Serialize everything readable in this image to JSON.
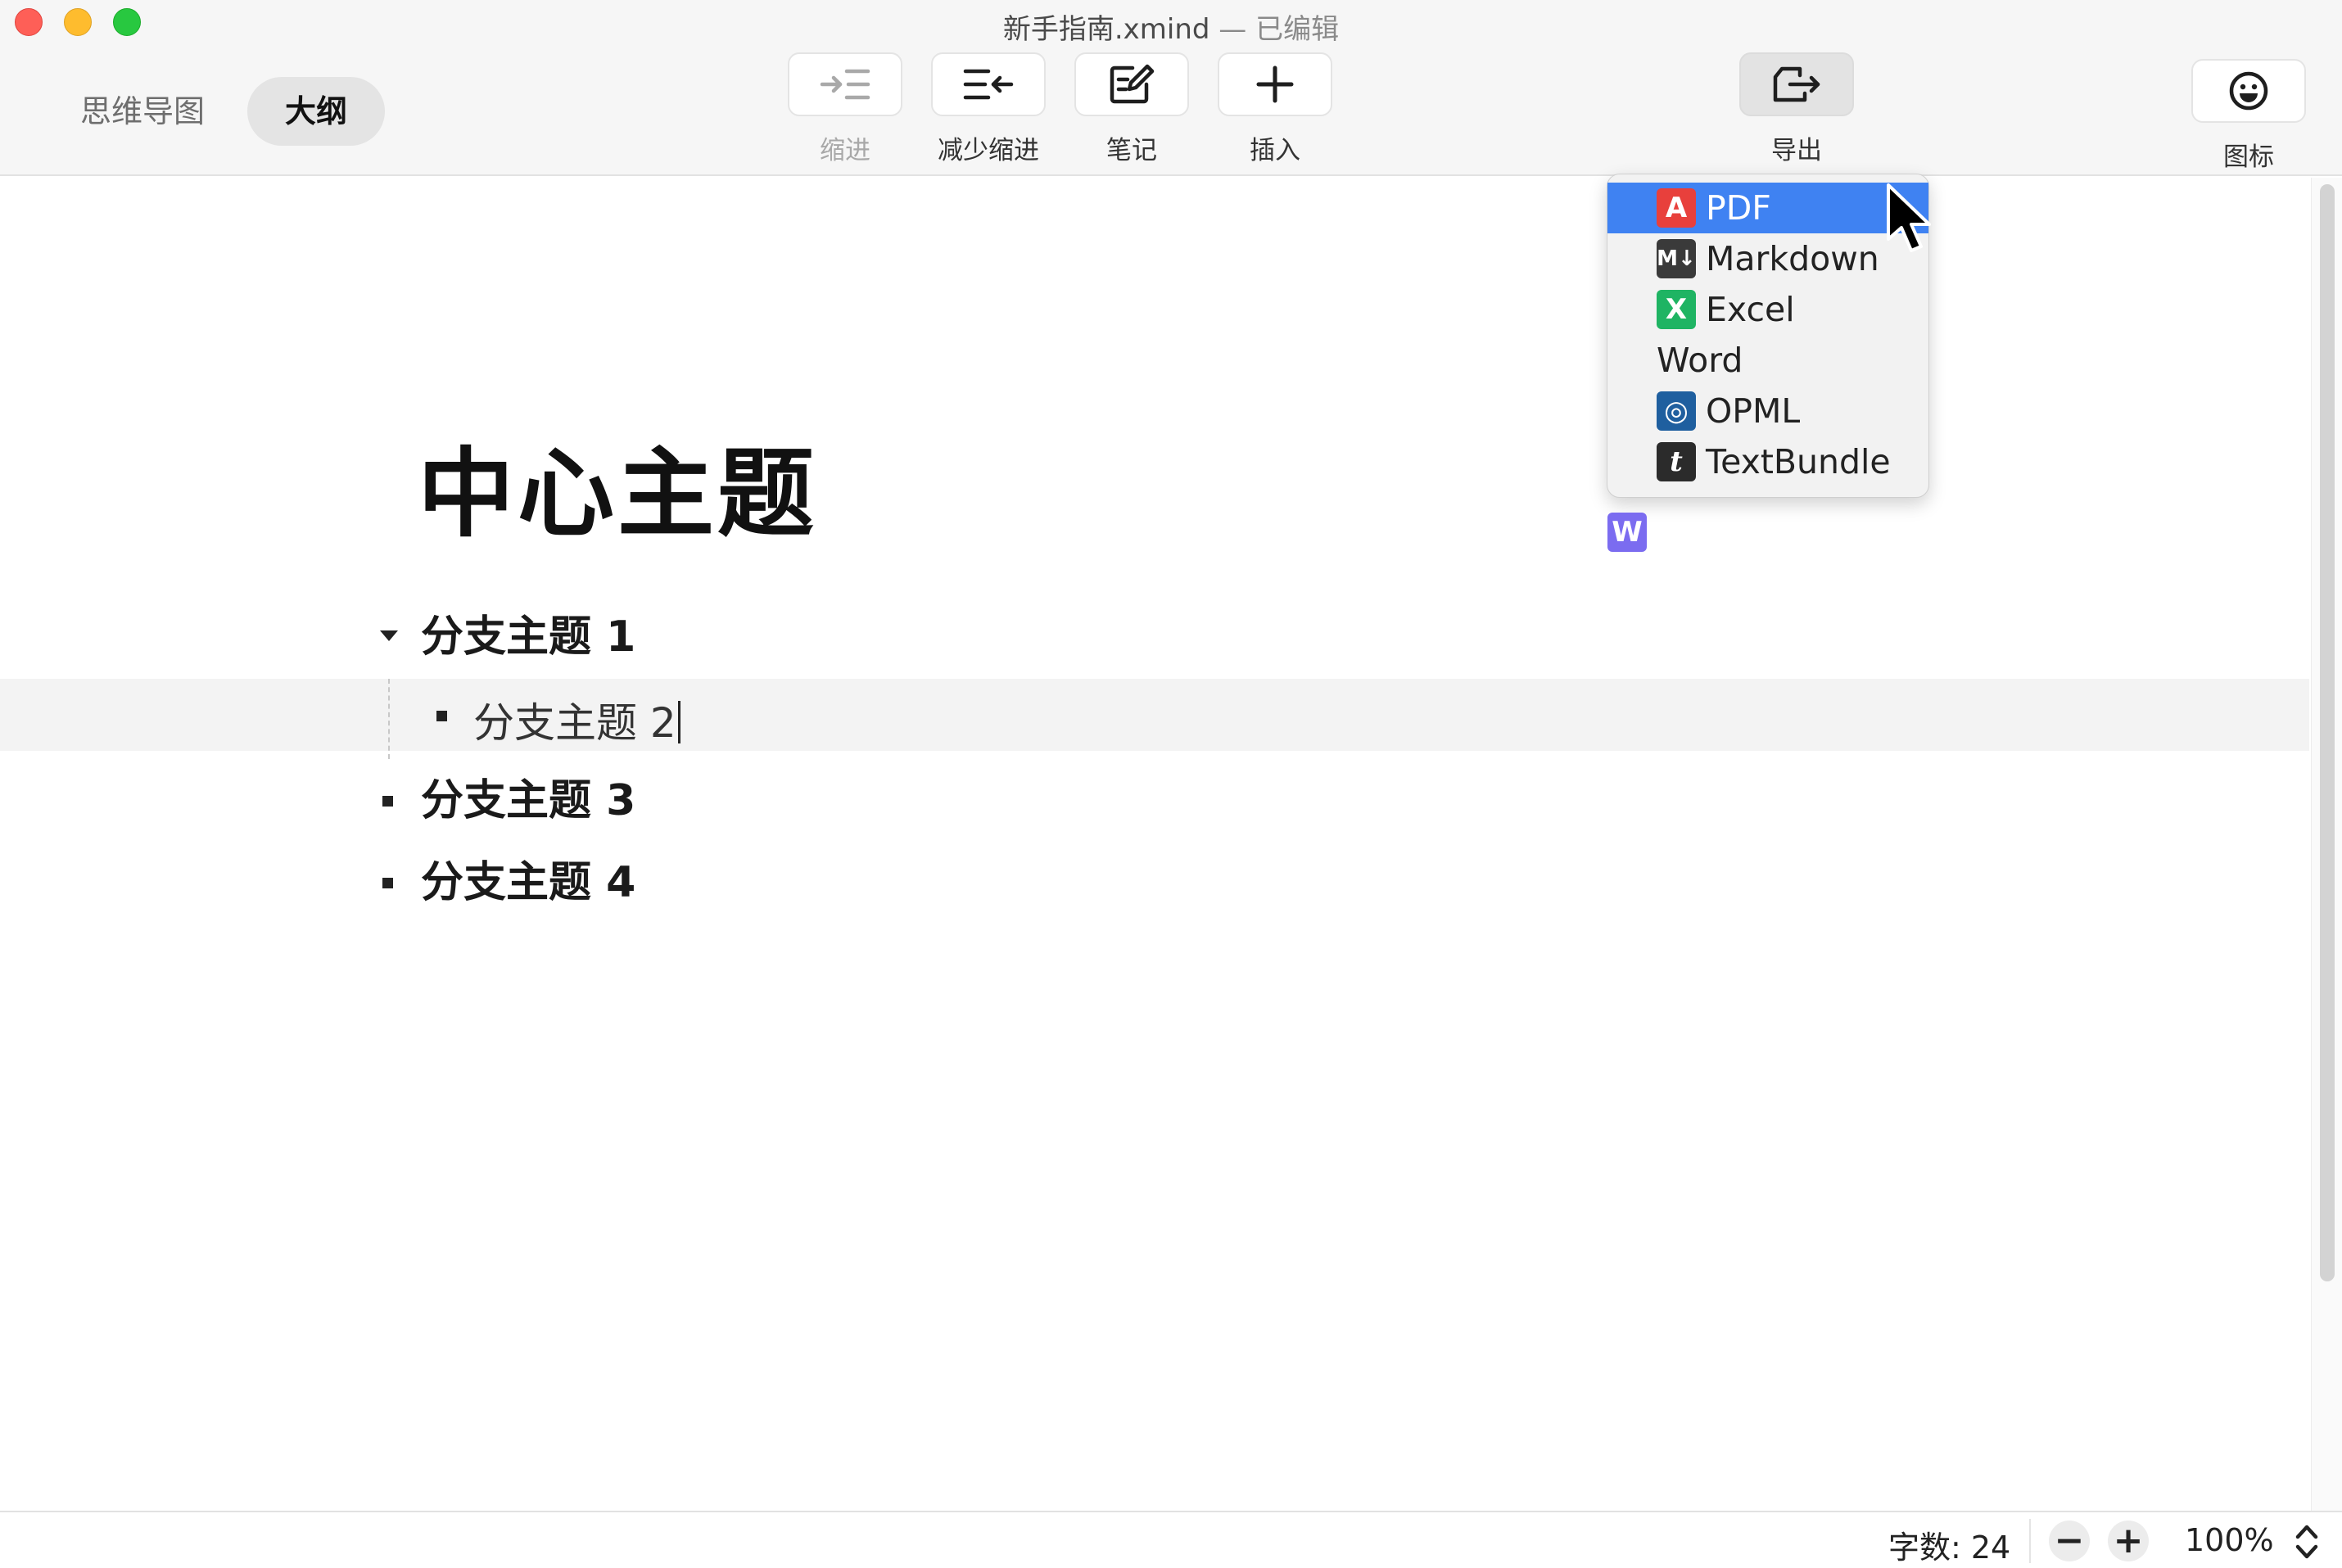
{
  "window": {
    "filename": "新手指南.xmind",
    "edited": " — 已编辑"
  },
  "views": {
    "mindmap": "思维导图",
    "outline": "大纲"
  },
  "toolbar": {
    "indent": "缩进",
    "outdent": "减少缩进",
    "notes": "笔记",
    "insert": "插入",
    "export": "导出",
    "icons": "图标"
  },
  "export_menu": {
    "items": [
      "PDF",
      "Markdown",
      "Excel",
      "Word",
      "OPML",
      "TextBundle"
    ],
    "selected": "PDF",
    "icon_glyphs": [
      "A",
      "M↓",
      "X",
      "W",
      "◎",
      "t"
    ]
  },
  "outline": {
    "central_topic": "中心主题",
    "topics": [
      "分支主题 1",
      "分支主题 2",
      "分支主题 3",
      "分支主题 4"
    ]
  },
  "statusbar": {
    "word_count": "字数: 24",
    "zoom_out": "−",
    "zoom_in": "+",
    "zoom": "100%"
  },
  "colors": {
    "accent": "#3f82f2",
    "pdf": "#e8403c",
    "excel": "#1fb463",
    "word": "#7b6cf0",
    "opml": "#1f5f9f"
  }
}
